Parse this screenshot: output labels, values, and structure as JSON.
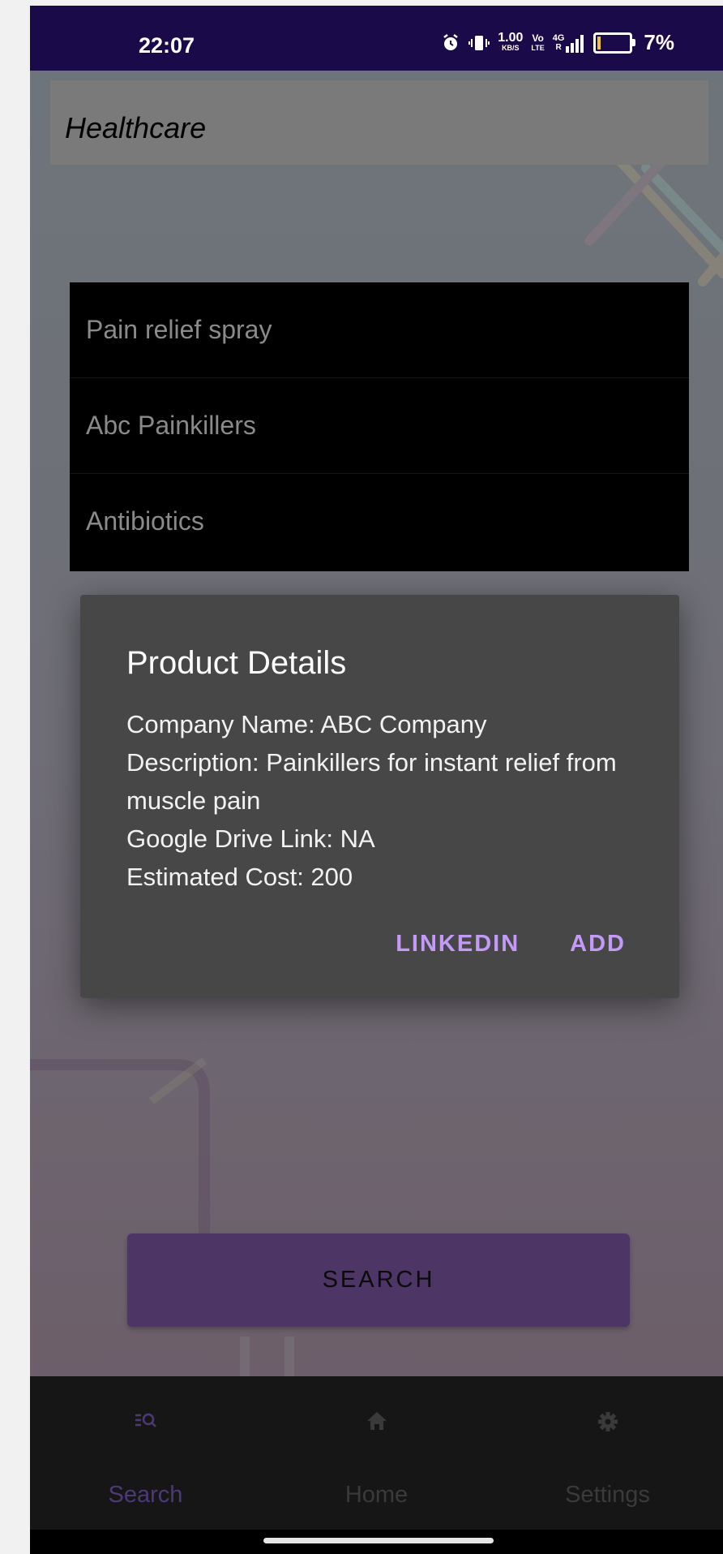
{
  "status_bar": {
    "time": "22:07",
    "speed": "1.00",
    "speed_unit": "KB/S",
    "volte_top": "Vo",
    "volte_bottom": "LTE",
    "network": "4G",
    "network_sub": "R",
    "battery": "7%",
    "icons": [
      "alarm-icon",
      "vibrate-icon",
      "signal-icon",
      "battery-icon"
    ]
  },
  "app_bar": {
    "title": "Healthcare"
  },
  "dropdown": {
    "items": [
      {
        "label": "Pain relief spray"
      },
      {
        "label": "Abc Painkillers"
      },
      {
        "label": "Antibiotics"
      }
    ]
  },
  "dialog": {
    "title": "Product Details",
    "lines": [
      "Company Name: ABC Company",
      "Description: Painkillers for instant relief from muscle pain",
      "Google Drive Link: NA",
      "Estimated Cost: 200"
    ],
    "actions": {
      "linkedin": "LINKEDIN",
      "add": "ADD"
    }
  },
  "search_button": {
    "label": "SEARCH"
  },
  "bottom_nav": {
    "items": [
      {
        "label": "Search",
        "icon": "search-list-icon",
        "active": true
      },
      {
        "label": "Home",
        "icon": "home-icon",
        "active": false
      },
      {
        "label": "Settings",
        "icon": "gear-icon",
        "active": false
      }
    ]
  },
  "colors": {
    "status_bar": "#1b0a4a",
    "accent": "#c39bf7",
    "search_button": "#4d3566",
    "dialog": "#474747"
  }
}
